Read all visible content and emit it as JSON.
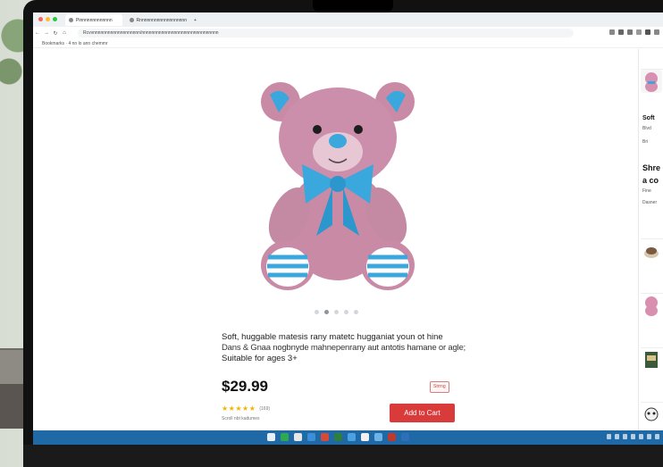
{
  "browser": {
    "tabs": [
      {
        "label": "Pinnnnnnnnnnnnn"
      },
      {
        "label": "Rnnnnnnnnnnnnnnnnnnn"
      }
    ],
    "url": "Rcvvnnnnnnnnnnnnnnnnnnn/nnnnnnnnnnnnnnnnnnnnnnnnnnnnnnn",
    "bookmarks": "Bookmarks · 4  nn lo ann chemmr",
    "nav": {
      "back": "←",
      "forward": "→",
      "reload": "↻",
      "home": "⌂"
    }
  },
  "product": {
    "description_line1": "Soft, huggable matesis rany matetc hugganiat youn ot hine",
    "description_line2": "Dans & Gnaa nogbnyde mahnepenrany aut antotis hamane or agle;",
    "description_line3": "Suitable for ages 3+",
    "price": "$29.99",
    "badge": "Strrng",
    "rating_stars": "★★★★★",
    "rating_count": "(169)",
    "reviews_link": "Scroll nbt kadumes",
    "add_to_cart": "Add to Cart",
    "carousel_count": 5,
    "carousel_active": 1
  },
  "sidebar": {
    "item1_title": "Soft",
    "item1_sub": "Blvd",
    "item1_meta": "Bri",
    "item2_title_a": "Shre",
    "item2_title_b": "a co",
    "item2_sub": "Fine",
    "item2_sub2": "Dasner"
  },
  "colors": {
    "bear_fur": "#c98aa6",
    "bow": "#3aa7dd",
    "accent": "#d93a3a",
    "taskbar": "#1f6aa6",
    "stars": "#f4b400"
  }
}
